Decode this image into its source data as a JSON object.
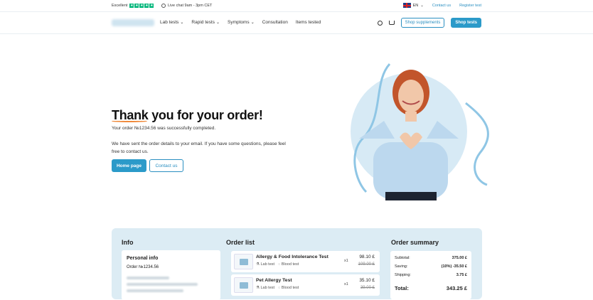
{
  "topbar": {
    "rating_label": "Excellent",
    "chat_text": "Live chat 9am - 3pm CET",
    "lang": "EN",
    "contact": "Contact us",
    "register": "Register test"
  },
  "nav": {
    "items": [
      {
        "label": "Lab tests",
        "dropdown": true
      },
      {
        "label": "Rapid tests",
        "dropdown": true
      },
      {
        "label": "Symptoms",
        "dropdown": true
      },
      {
        "label": "Consultation",
        "dropdown": false
      },
      {
        "label": "Items tested",
        "dropdown": false
      }
    ],
    "shop_supplements": "Shop supplements",
    "shop_tests": "Shop tests"
  },
  "hero": {
    "title": "Thank you for your order!",
    "line1": "Your order №1234.56 was successfully completed.",
    "line2": "We have sent the order details to your email. If you have some questions, please feel free to contact us.",
    "home_btn": "Home page",
    "contact_btn": "Contact us"
  },
  "info": {
    "heading": "Info",
    "personal_title": "Personal info",
    "order_no": "Order №1234.56"
  },
  "order_list": {
    "heading": "Order list",
    "items": [
      {
        "name": "Allergy & Food Intolerance Test",
        "tag1": "Lab test",
        "tag2": "Blood test",
        "qty": "x1",
        "price": "98.10 £",
        "old_price": "109.00 £"
      },
      {
        "name": "Pet Allergy Test",
        "tag1": "Lab test",
        "tag2": "Blood test",
        "qty": "x1",
        "price": "35.10 £",
        "old_price": "39.00 £"
      }
    ]
  },
  "summary": {
    "heading": "Order summary",
    "subtotal_label": "Subtotal:",
    "subtotal": "375.00 £",
    "saving_label": "Saving:",
    "saving": "(10%) -35.50 £",
    "shipping_label": "Shipping:",
    "shipping": "3.75 £",
    "total_label": "Total:",
    "total": "343.25 £"
  },
  "colors": {
    "accent": "#2b9ac9",
    "panel": "#dcecf4",
    "trustpilot": "#00b67a",
    "underline": "#f08a3c"
  }
}
